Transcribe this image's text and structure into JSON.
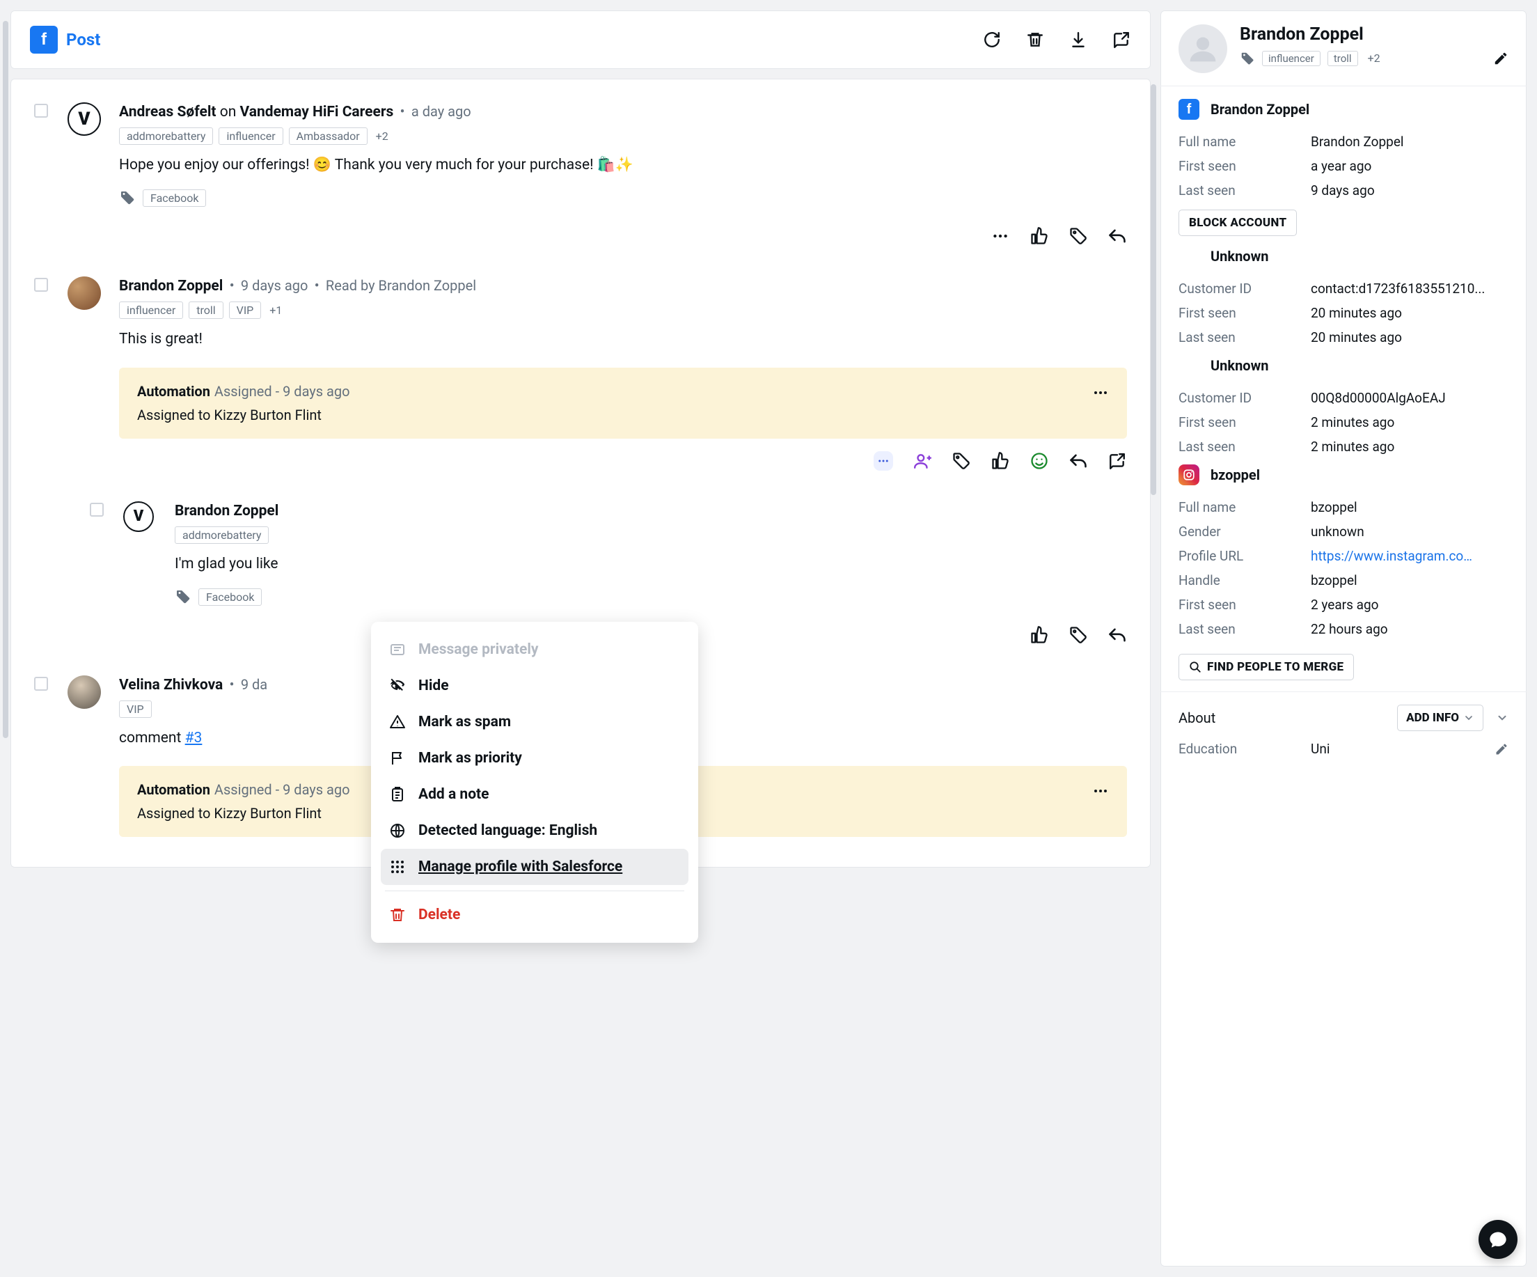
{
  "header": {
    "title": "Post"
  },
  "posts": [
    {
      "author": "Andreas Søfelt",
      "on": "on",
      "page": "Vandemay HiFi Careers",
      "time": "a day ago",
      "tags": [
        "addmorebattery",
        "influencer",
        "Ambassador"
      ],
      "tag_more": "+2",
      "text": "Hope you enjoy our offerings! 😊 Thank you very much for your purchase! 🛍️✨",
      "bottom_tag": "Facebook"
    },
    {
      "author": "Brandon Zoppel",
      "time": "9 days ago",
      "read_by": "Read by Brandon Zoppel",
      "tags": [
        "influencer",
        "troll",
        "VIP"
      ],
      "tag_more": "+1",
      "text": "This is great!",
      "automation": {
        "title": "Automation",
        "meta": "Assigned - 9 days ago",
        "body": "Assigned to Kizzy Burton Flint"
      }
    },
    {
      "author": "Brandon Zoppel",
      "tags": [
        "addmorebattery"
      ],
      "text": "I'm glad you like",
      "bottom_tag": "Facebook"
    },
    {
      "author": "Velina Zhivkova",
      "time": "9 da",
      "tags": [
        "VIP"
      ],
      "text_prefix": "comment ",
      "text_link": "#3",
      "automation": {
        "title": "Automation",
        "meta": "Assigned - 9 days ago",
        "body": "Assigned to Kizzy Burton Flint"
      }
    }
  ],
  "menu": {
    "message_privately": "Message privately",
    "hide": "Hide",
    "spam": "Mark as spam",
    "priority": "Mark as priority",
    "note": "Add a note",
    "lang_label": "Detected language: ",
    "lang_value": "English",
    "salesforce": "Manage profile with Salesforce",
    "delete": "Delete"
  },
  "side": {
    "name": "Brandon Zoppel",
    "tags": [
      "influencer",
      "troll"
    ],
    "tag_more": "+2",
    "identities": [
      {
        "kind": "fb",
        "label": "Brandon Zoppel",
        "rows": [
          {
            "k": "Full name",
            "v": "Brandon Zoppel"
          },
          {
            "k": "First seen",
            "v": "a year ago"
          },
          {
            "k": "Last seen",
            "v": "9 days ago"
          }
        ],
        "button": "BLOCK ACCOUNT"
      },
      {
        "kind": "blank",
        "label": "Unknown",
        "rows": [
          {
            "k": "Customer ID",
            "v": "contact:d1723f6183551210..."
          },
          {
            "k": "First seen",
            "v": "20 minutes ago"
          },
          {
            "k": "Last seen",
            "v": "20 minutes ago"
          }
        ]
      },
      {
        "kind": "blank",
        "label": "Unknown",
        "rows": [
          {
            "k": "Customer ID",
            "v": "00Q8d00000AlgAoEAJ"
          },
          {
            "k": "First seen",
            "v": "2 minutes ago"
          },
          {
            "k": "Last seen",
            "v": "2 minutes ago"
          }
        ]
      },
      {
        "kind": "ig",
        "label": "bzoppel",
        "rows": [
          {
            "k": "Full name",
            "v": "bzoppel"
          },
          {
            "k": "Gender",
            "v": "unknown"
          },
          {
            "k": "Profile URL",
            "v": "https://www.instagram.co…",
            "link": true
          },
          {
            "k": "Handle",
            "v": "bzoppel"
          },
          {
            "k": "First seen",
            "v": "2 years ago"
          },
          {
            "k": "Last seen",
            "v": "22 hours ago"
          }
        ]
      }
    ],
    "merge_btn": "FIND PEOPLE TO MERGE",
    "about": {
      "title": "About",
      "add": "ADD INFO",
      "education_k": "Education",
      "education_v": "Uni"
    }
  }
}
